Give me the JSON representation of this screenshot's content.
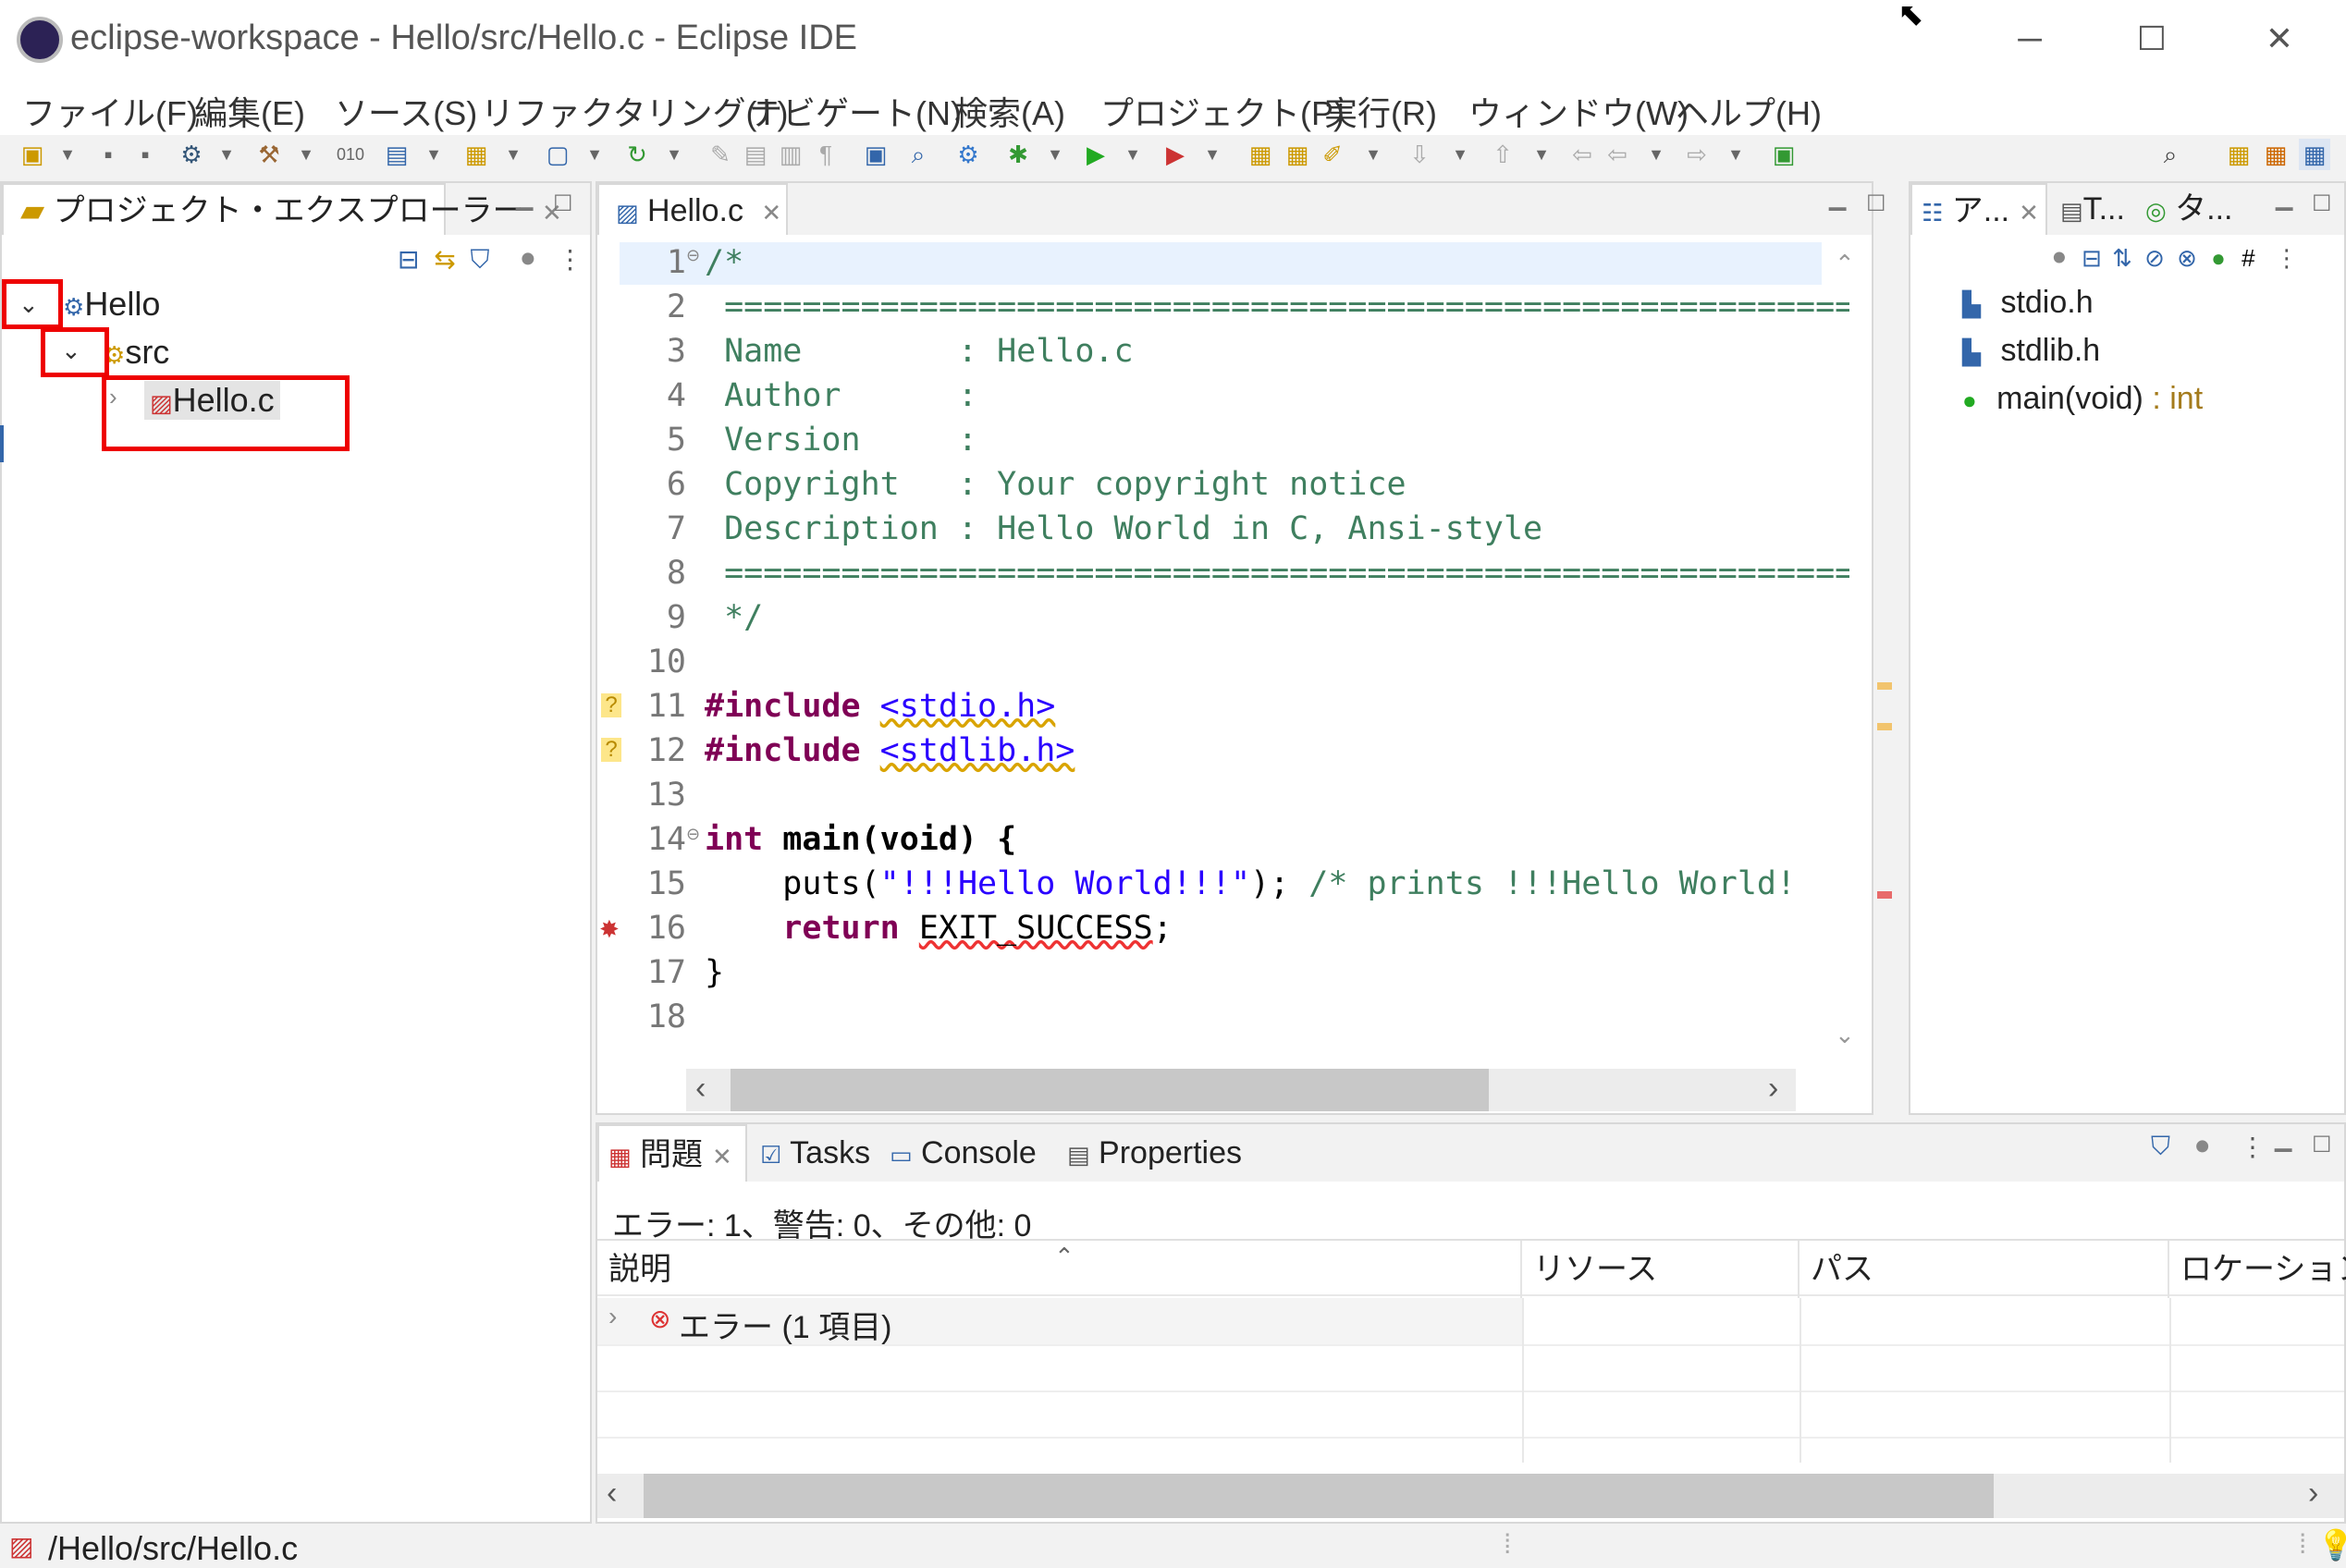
{
  "window": {
    "title": "eclipse-workspace - Hello/src/Hello.c - Eclipse IDE",
    "minimize": "─",
    "maximize": "☐",
    "close": "✕"
  },
  "menu": [
    "ファイル(F)",
    "編集(E)",
    "ソース(S)",
    "リファクタリング(T)",
    "ナビゲート(N)",
    "検索(A)",
    "プロジェクト(P)",
    "実行(R)",
    "ウィンドウ(W)",
    "ヘルプ(H)"
  ],
  "explorer": {
    "tab_label": "プロジェクト・エクスプローラー",
    "tree": [
      {
        "label": "Hello",
        "depth": 0,
        "expanded": true
      },
      {
        "label": "src",
        "depth": 1,
        "expanded": true
      },
      {
        "label": "Hello.c",
        "depth": 2,
        "expanded": false,
        "selected": true
      }
    ]
  },
  "editor": {
    "tab_label": "Hello.c",
    "line_numbers": [
      "1",
      "2",
      "3",
      "4",
      "5",
      "6",
      "7",
      "8",
      "9",
      "10",
      "11",
      "12",
      "13",
      "14",
      "15",
      "16",
      "17",
      "18"
    ],
    "lines": [
      "/*",
      " ============================================================",
      " Name        : Hello.c",
      " Author      :",
      " Version     :",
      " Copyright   : Your copyright notice",
      " Description : Hello World in C, Ansi-style",
      " ============================================================",
      " */",
      "",
      "#include <stdio.h>",
      "#include <stdlib.h>",
      "",
      "int main(void) {",
      "    puts(\"!!!Hello World!!!\"); /* prints !!!Hello World!",
      "    return EXIT_SUCCESS;",
      "}",
      ""
    ],
    "tokens": {
      "include": "#include",
      "stdio": "<stdio.h>",
      "stdlib": "<stdlib.h>",
      "int": "int",
      "main": " main(void) {",
      "puts": "    puts(",
      "puts_str": "\"!!!Hello World!!!\"",
      "puts_end": "); ",
      "puts_comment": "/* prints !!!Hello World!",
      "return": "return",
      "exit": "EXIT_SUCCESS",
      "semicolon": ";",
      "close_brace": "}"
    }
  },
  "outline": {
    "tabs": [
      "ア...",
      "T...",
      "タ..."
    ],
    "items": [
      {
        "label": "stdio.h",
        "suffix": ""
      },
      {
        "label": "stdlib.h",
        "suffix": ""
      },
      {
        "label": "main(void)",
        "suffix": " : int"
      }
    ]
  },
  "bottom": {
    "tabs": [
      "問題",
      "Tasks",
      "Console",
      "Properties"
    ],
    "summary": "エラー: 1、警告: 0、その他: 0",
    "columns": [
      "説明",
      "リソース",
      "パス",
      "ロケーション"
    ],
    "rows": [
      {
        "description": "エラー (1 項目)"
      }
    ]
  },
  "status": {
    "path": "/Hello/src/Hello.c"
  },
  "colors": {
    "accent_red_box": "#e00000",
    "comment": "#3f7f5f",
    "keyword": "#7f0055",
    "string": "#2a00ff"
  }
}
